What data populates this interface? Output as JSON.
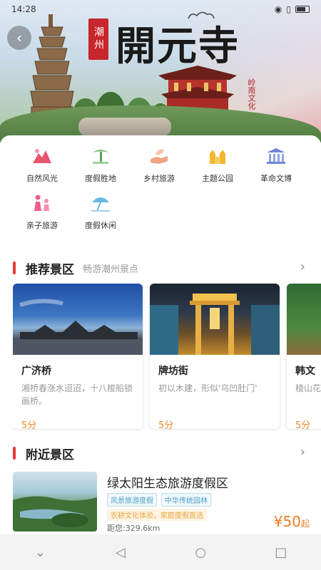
{
  "status": {
    "time": "14:28",
    "icons": [
      "sim-icon",
      "wifi-icon",
      "eye-icon",
      "vibrate-icon",
      "battery-icon"
    ]
  },
  "hero": {
    "seal_text": "潮州",
    "title": "開元寺",
    "subtitle": "岭南文化"
  },
  "categories": [
    {
      "label": "自然风光",
      "icon": "mountain-icon",
      "color": "#e8556d"
    },
    {
      "label": "度假胜地",
      "icon": "palm-tree-icon",
      "color": "#7cc07a"
    },
    {
      "label": "乡村旅游",
      "icon": "hand-leaf-icon",
      "color": "#f0a582"
    },
    {
      "label": "主题公园",
      "icon": "castle-icon",
      "color": "#f3b62d"
    },
    {
      "label": "革命文博",
      "icon": "museum-icon",
      "color": "#6f86d6"
    },
    {
      "label": "亲子旅游",
      "icon": "family-icon",
      "color": "#ee5d8e"
    },
    {
      "label": "度假休闲",
      "icon": "umbrella-icon",
      "color": "#69b9e2"
    }
  ],
  "recommended": {
    "title": "推荐景区",
    "subtitle": "畅游潮州景点",
    "items": [
      {
        "name": "广济桥",
        "desc": "湘桥春涨水迢迢，十八梭船锁画桥。",
        "score": "5分"
      },
      {
        "name": "牌坊街",
        "desc": "初以木建，形似'乌凹肚门'",
        "score": "5分"
      },
      {
        "name": "韩文",
        "desc": "棱山花丛",
        "score": "5分"
      }
    ]
  },
  "nearby": {
    "title": "附近景区",
    "item": {
      "name": "绿太阳生态旅游度假区",
      "tags": [
        "风景旅游度假",
        "中华传统园林"
      ],
      "promo": "农耕文化体验，家庭度假首选",
      "distance": "距您:329.6km",
      "price": "¥50",
      "price_unit": "起"
    }
  },
  "navbar": [
    "chevron-down-icon",
    "back-triangle-icon",
    "home-circle-icon",
    "recents-square-icon"
  ]
}
